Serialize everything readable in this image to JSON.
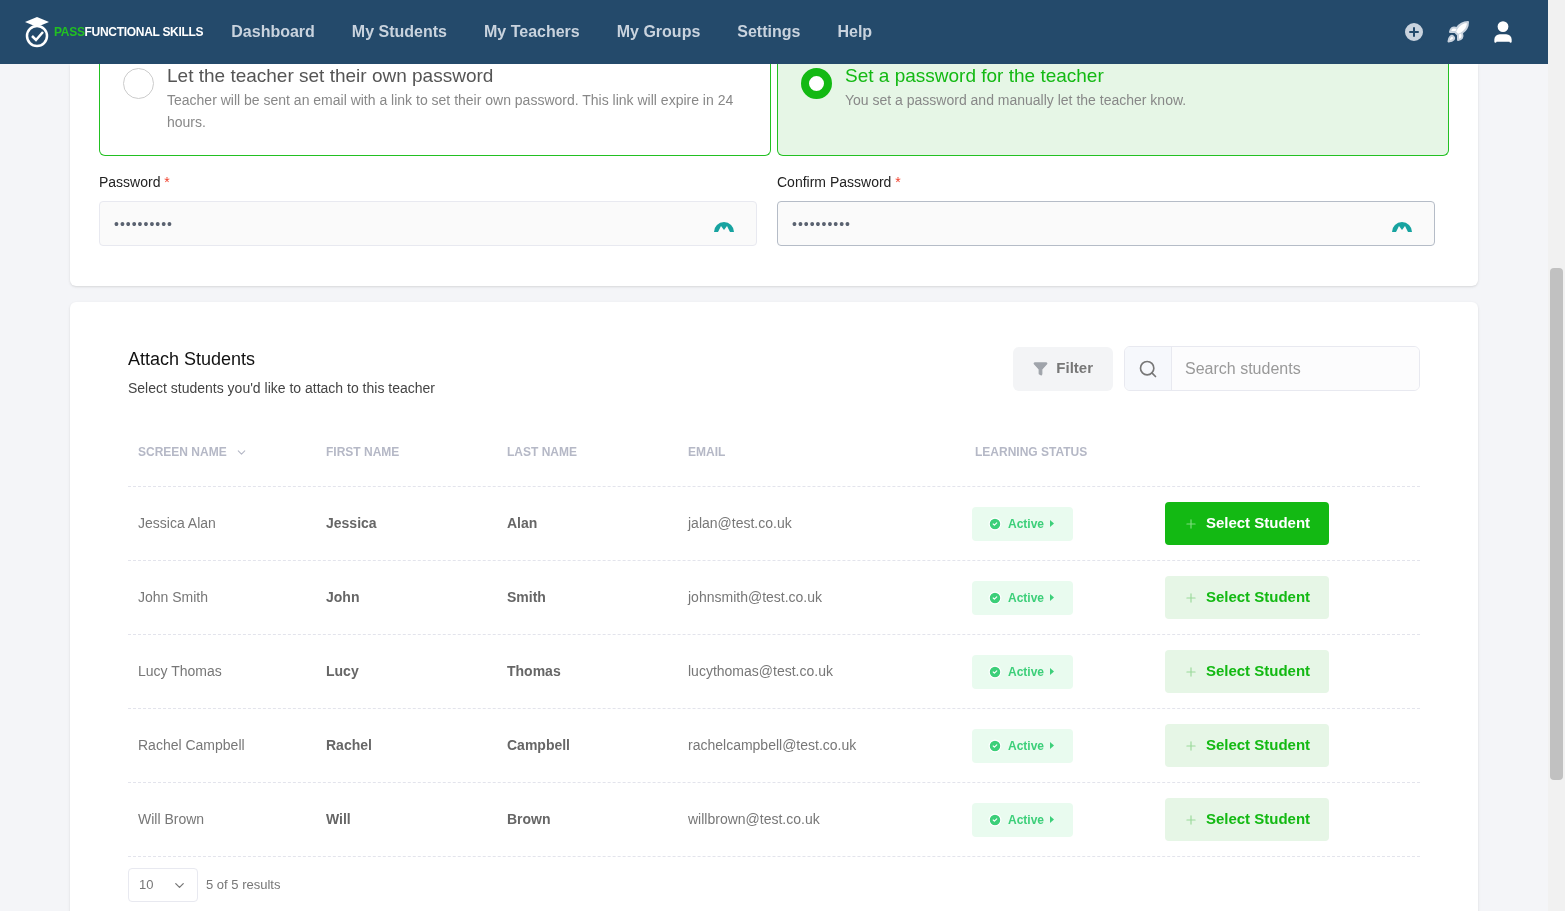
{
  "nav": {
    "logo": {
      "accent": "PASS",
      "rest": "FUNCTIONAL SKILLS"
    },
    "items": [
      {
        "label": "Dashboard"
      },
      {
        "label": "My Students"
      },
      {
        "label": "My Teachers"
      },
      {
        "label": "My Groups"
      },
      {
        "label": "Settings"
      },
      {
        "label": "Help"
      }
    ]
  },
  "password_options": [
    {
      "title": "Let the teacher set their own password",
      "description": "Teacher will be sent an email with a link to set their own password. This link will expire in 24 hours.",
      "selected": false
    },
    {
      "title": "Set a password for the teacher",
      "description": "You set a password and manually let the teacher know.",
      "selected": true
    }
  ],
  "fields": [
    {
      "label": "Password",
      "required_mark": "*",
      "value": "••••••••••",
      "focused": false
    },
    {
      "label": "Confirm Password",
      "required_mark": "*",
      "value": "••••••••••",
      "focused": true
    }
  ],
  "attach": {
    "title": "Attach Students",
    "subtitle": "Select students you'd like to attach to this teacher",
    "filter": "Filter",
    "search": {
      "placeholder": "Search students"
    },
    "columns": [
      {
        "label": "SCREEN NAME",
        "sortable": true
      },
      {
        "label": "FIRST NAME",
        "sortable": false
      },
      {
        "label": "LAST NAME",
        "sortable": false
      },
      {
        "label": "EMAIL",
        "sortable": false
      },
      {
        "label": "LEARNING STATUS",
        "sortable": false
      }
    ],
    "rows": [
      {
        "screen_name": "Jessica Alan",
        "first_name": "Jessica",
        "last_name": "Alan",
        "email": "jalan@test.co.uk",
        "status": "Active",
        "action": "Select Student",
        "selected": true
      },
      {
        "screen_name": "John Smith",
        "first_name": "John",
        "last_name": "Smith",
        "email": "johnsmith@test.co.uk",
        "status": "Active",
        "action": "Select Student",
        "selected": false
      },
      {
        "screen_name": "Lucy Thomas",
        "first_name": "Lucy",
        "last_name": "Thomas",
        "email": "lucythomas@test.co.uk",
        "status": "Active",
        "action": "Select Student",
        "selected": false
      },
      {
        "screen_name": "Rachel Campbell",
        "first_name": "Rachel",
        "last_name": "Campbell",
        "email": "rachelcampbell@test.co.uk",
        "status": "Active",
        "action": "Select Student",
        "selected": false
      },
      {
        "screen_name": "Will Brown",
        "first_name": "Will",
        "last_name": "Brown",
        "email": "willbrown@test.co.uk",
        "status": "Active",
        "action": "Select Student",
        "selected": false
      }
    ],
    "page_size": "10",
    "results": "5 of 5 results"
  }
}
